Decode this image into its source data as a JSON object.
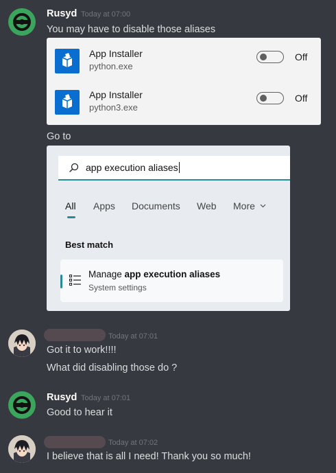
{
  "messages": [
    {
      "author": "Rusyd",
      "timestamp": "Today at 07:00",
      "lines": [
        "You may have to disable those aliases"
      ],
      "aliases": [
        {
          "name": "App Installer",
          "exe": "python.exe",
          "state": "Off"
        },
        {
          "name": "App Installer",
          "exe": "python3.exe",
          "state": "Off"
        }
      ],
      "line_after": "Go to",
      "search": {
        "query": "app execution aliases",
        "tabs": [
          "All",
          "Apps",
          "Documents",
          "Web",
          "More"
        ],
        "section": "Best match",
        "result_prefix": "Manage ",
        "result_bold": "app execution aliases",
        "result_sub": "System settings"
      }
    },
    {
      "author": "",
      "timestamp": "Today at 07:01",
      "lines": [
        "Got it to work!!!!",
        "What did disabling those do ?"
      ]
    },
    {
      "author": "Rusyd",
      "timestamp": "Today at 07:01",
      "lines": [
        "Good to hear it"
      ]
    },
    {
      "author": "",
      "timestamp": "Today at 07:02",
      "lines": [
        "I believe that is all I need! Thank you so much!"
      ]
    }
  ],
  "colors": {
    "background": "#36393f",
    "accent_teal": "#2a8a94",
    "avatar_green": "#3ba55d",
    "app_icon_blue": "#0a6ed1"
  },
  "icons": [
    "bot-avatar-icon",
    "user-avatar-icon",
    "app-installer-icon",
    "search-icon",
    "chevron-down-icon",
    "settings-list-icon"
  ]
}
